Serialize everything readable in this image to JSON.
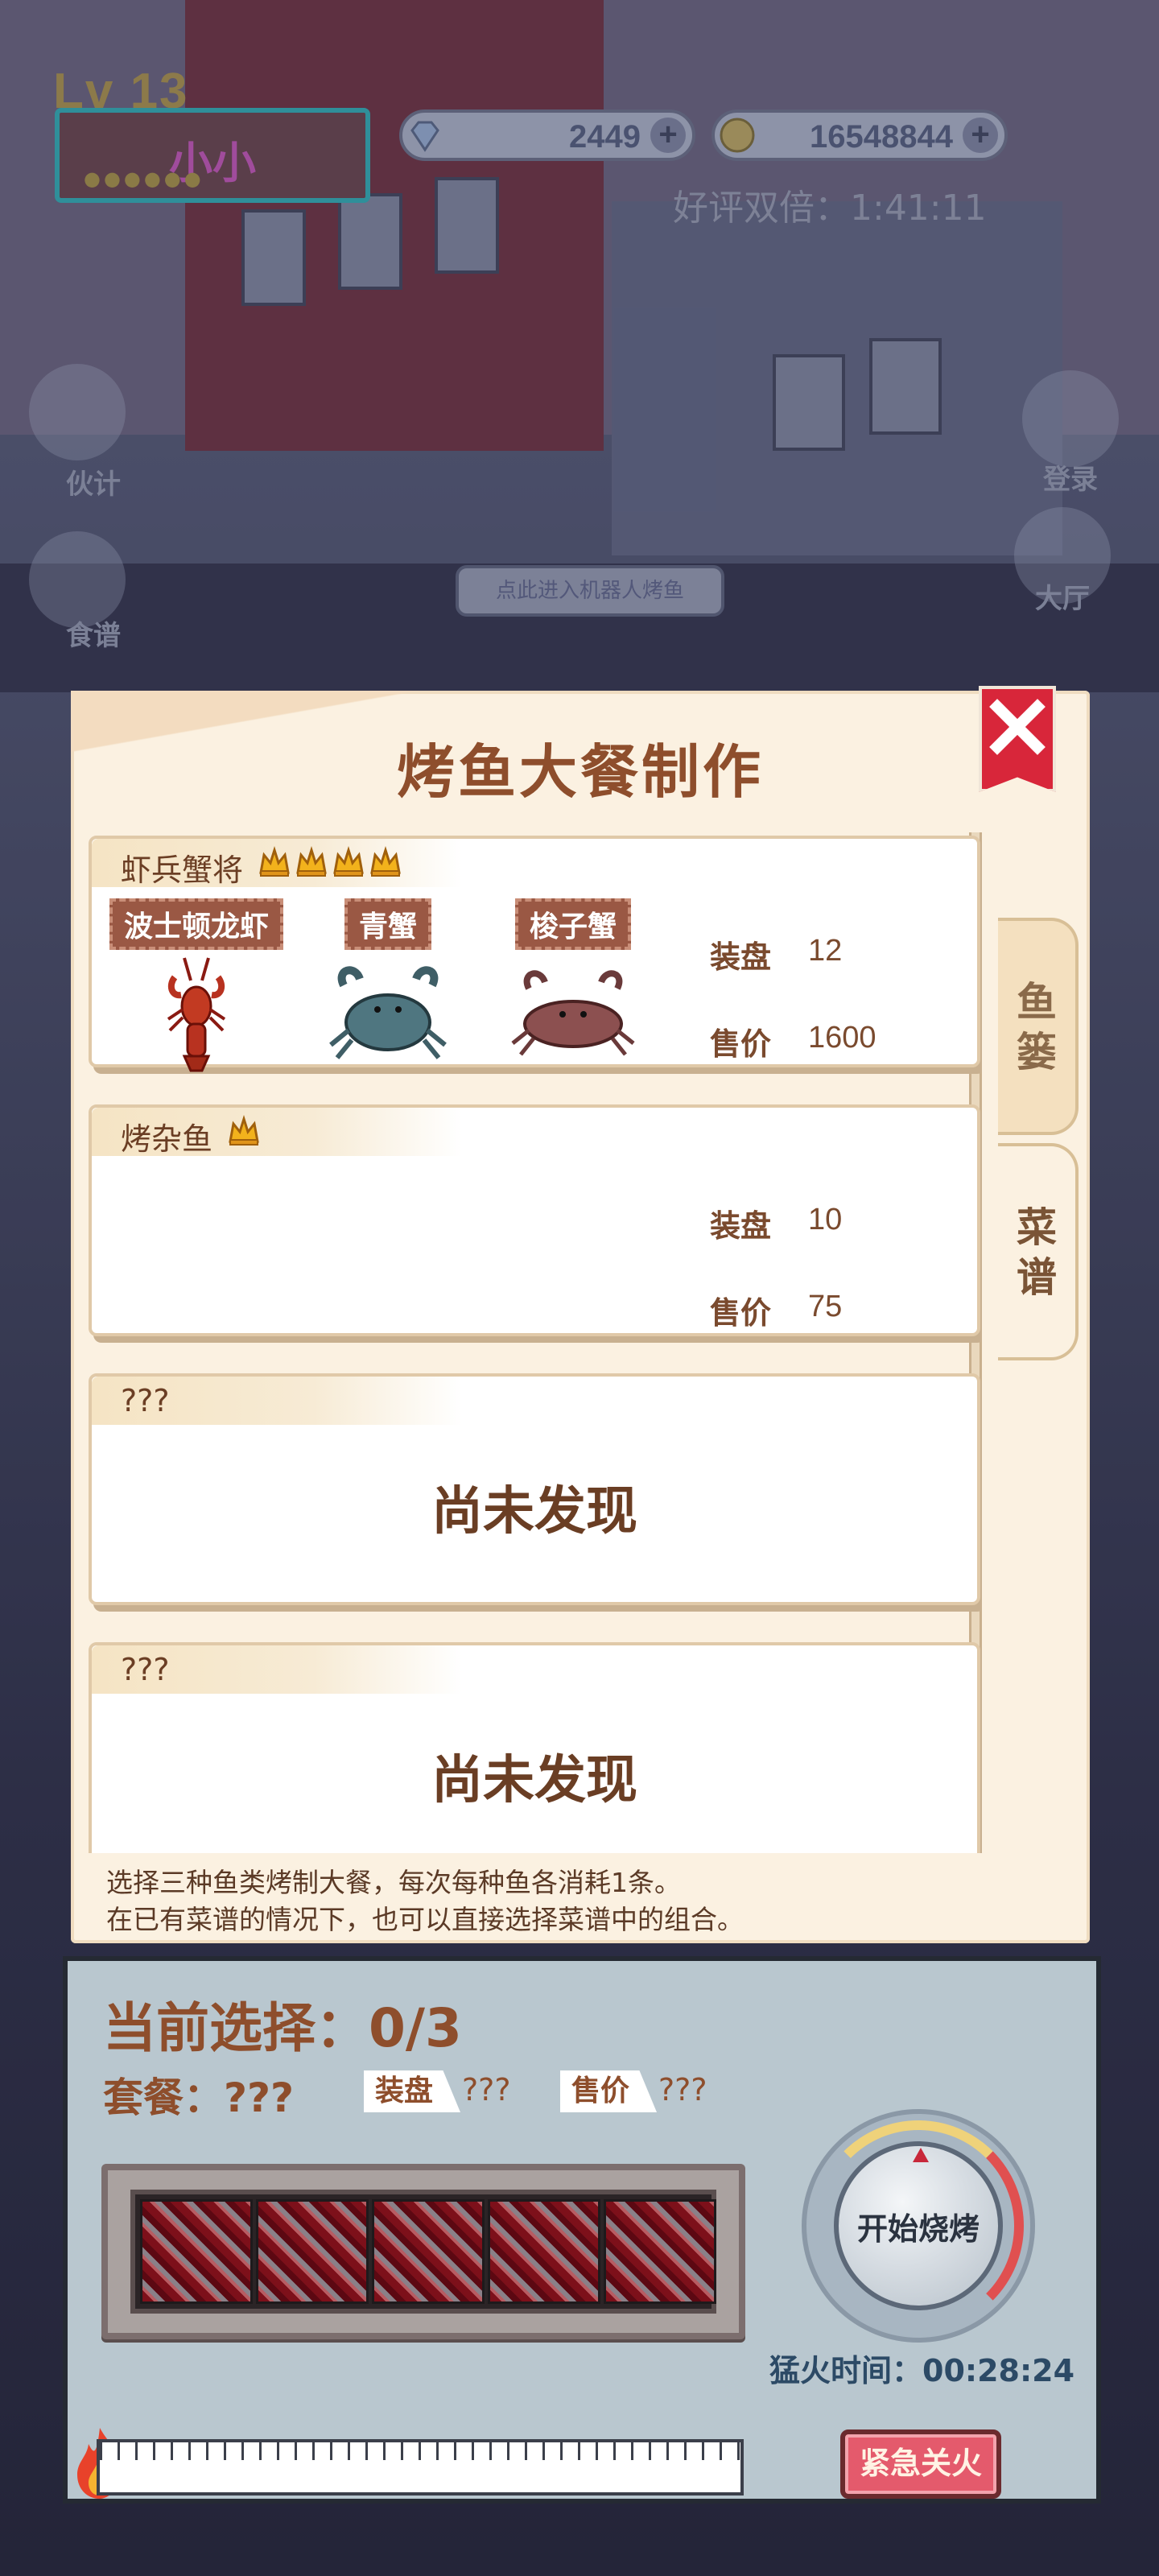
{
  "hud": {
    "level": "Lv 13",
    "player_name": "小小",
    "gems": "2449",
    "coins": "16548844",
    "bonus_text": "好评双倍：1:41:11"
  },
  "scene": {
    "left_menu": [
      {
        "label": "伙计",
        "icon": "chef-hat-icon"
      },
      {
        "label": "食谱",
        "icon": "skewer-icon"
      }
    ],
    "right_menu": [
      {
        "label": "登录",
        "icon": "calendar-icon"
      },
      {
        "label": "大厅",
        "icon": "teapot-icon"
      }
    ],
    "robot_hint": "点此进入机器人烤鱼"
  },
  "recipe_panel": {
    "title": "烤鱼大餐制作",
    "tabs": [
      {
        "label_top": "鱼",
        "label_bottom": "篓",
        "active": false
      },
      {
        "label_top": "菜",
        "label_bottom": "谱",
        "active": true
      }
    ],
    "recipes": [
      {
        "name": "虾兵蟹将",
        "stars": 4,
        "ingredients": [
          {
            "name": "波士顿龙虾",
            "icon": "lobster-icon"
          },
          {
            "name": "青蟹",
            "icon": "green-crab-icon"
          },
          {
            "name": "梭子蟹",
            "icon": "swimming-crab-icon"
          }
        ],
        "plate_label": "装盘",
        "plate": "12",
        "price_label": "售价",
        "price": "1600"
      },
      {
        "name": "烤杂鱼",
        "stars": 1,
        "ingredients": [],
        "plate_label": "装盘",
        "plate": "10",
        "price_label": "售价",
        "price": "75"
      },
      {
        "name": "???",
        "undiscovered": "尚未发现"
      },
      {
        "name": "???",
        "undiscovered": "尚未发现"
      }
    ],
    "help_lines": [
      "选择三种鱼类烤制大餐，每次每种鱼各消耗1条。",
      "在已有菜谱的情况下，也可以直接选择菜谱中的组合。"
    ]
  },
  "grill": {
    "current_selection": "当前选择：0/3",
    "combo_label": "套餐：???",
    "plate_label": "装盘",
    "plate_value": "???",
    "price_label": "售价",
    "price_value": "???",
    "start_button": "开始烧烤",
    "fire_time": "猛火时间：00:28:24",
    "emergency_button": "紧急关火"
  },
  "colors": {
    "accent_brown": "#8e4e2c",
    "close_red": "#d8263a",
    "panel_cream": "#fbf1e1",
    "grill_bg": "#b9c7cf",
    "star_gold": "#f2b21c"
  }
}
